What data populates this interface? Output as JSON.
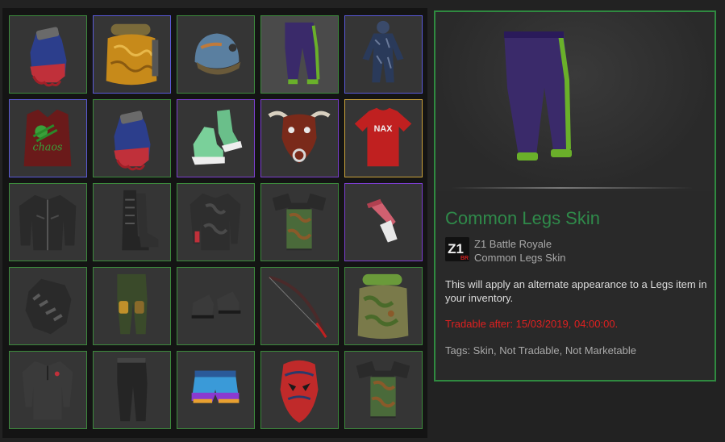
{
  "inventory": {
    "items": [
      {
        "icon": "fingerless-glove-icon",
        "rarity": "green"
      },
      {
        "icon": "backpack-icon",
        "rarity": "blue"
      },
      {
        "icon": "helmet-icon",
        "rarity": "green"
      },
      {
        "icon": "purple-pants-icon",
        "rarity": "green",
        "selected": true
      },
      {
        "icon": "ghillie-suit-icon",
        "rarity": "blue"
      },
      {
        "icon": "chaos-vest-icon",
        "rarity": "blue",
        "logo_text": "chaos"
      },
      {
        "icon": "fingerless-glove-icon",
        "rarity": "green"
      },
      {
        "icon": "green-sneakers-icon",
        "rarity": "purple"
      },
      {
        "icon": "bull-mask-icon",
        "rarity": "purple"
      },
      {
        "icon": "red-tshirt-icon",
        "rarity": "gold",
        "logo_text": "NAX"
      },
      {
        "icon": "leather-jacket-icon",
        "rarity": "green"
      },
      {
        "icon": "combat-boots-icon",
        "rarity": "green"
      },
      {
        "icon": "camo-shirt-icon",
        "rarity": "green"
      },
      {
        "icon": "camo-armor-icon",
        "rarity": "green"
      },
      {
        "icon": "red-pistol-icon",
        "rarity": "purple"
      },
      {
        "icon": "tactical-glove-icon",
        "rarity": "green"
      },
      {
        "icon": "cargo-pants-icon",
        "rarity": "green"
      },
      {
        "icon": "low-boots-icon",
        "rarity": "green"
      },
      {
        "icon": "bow-icon",
        "rarity": "green"
      },
      {
        "icon": "camo-backpack-icon",
        "rarity": "green"
      },
      {
        "icon": "henley-shirt-icon",
        "rarity": "green"
      },
      {
        "icon": "black-pants-icon",
        "rarity": "green"
      },
      {
        "icon": "shorts-icon",
        "rarity": "green"
      },
      {
        "icon": "red-mask-icon",
        "rarity": "green"
      },
      {
        "icon": "camo-armor-icon",
        "rarity": "green"
      }
    ]
  },
  "details": {
    "item_name": "Common Legs Skin",
    "game_logo_text": "Z1",
    "game_logo_subtext": "BR",
    "game_name": "Z1 Battle Royale",
    "item_type": "Common Legs Skin",
    "description": "This will apply an alternate appearance to a Legs item in your inventory.",
    "tradable": "Tradable after: 15/03/2019, 04:00:00.",
    "tags": "Tags: Skin, Not Tradable, Not Marketable",
    "preview_icon": "purple-pants-icon"
  },
  "colors": {
    "rarity_green": "#3c8a3c",
    "rarity_blue": "#5a5ad8",
    "rarity_purple": "#7b3ed0",
    "rarity_gold": "#c9a23a",
    "name_color": "#2f8a4a",
    "tradable_color": "#e02020"
  }
}
